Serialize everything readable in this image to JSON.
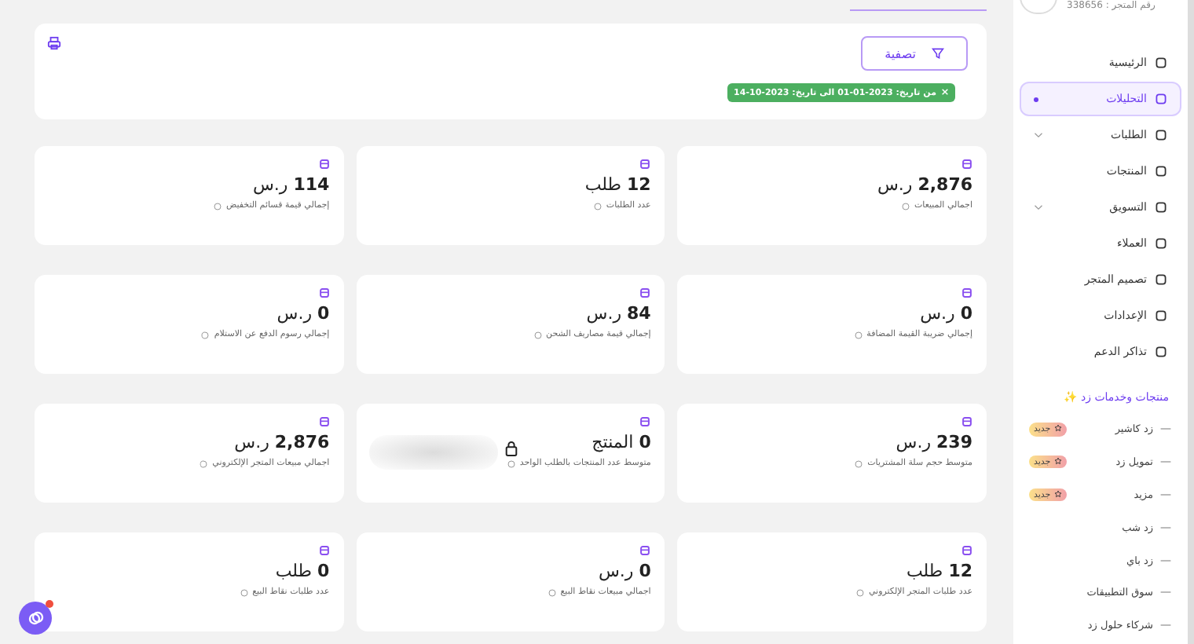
{
  "store": {
    "number_label": "رقم المتجر : 338656"
  },
  "nav": [
    {
      "label": "الرئيسية",
      "selected": false,
      "expandable": false
    },
    {
      "label": "التحليلات",
      "selected": true,
      "expandable": false
    },
    {
      "label": "الطلبات",
      "selected": false,
      "expandable": true
    },
    {
      "label": "المنتجات",
      "selected": false,
      "expandable": false
    },
    {
      "label": "التسويق",
      "selected": false,
      "expandable": true
    },
    {
      "label": "العملاء",
      "selected": false,
      "expandable": false
    },
    {
      "label": "تصميم المتجر",
      "selected": false,
      "expandable": false
    },
    {
      "label": "الإعدادات",
      "selected": false,
      "expandable": false
    },
    {
      "label": "تذاكر الدعم",
      "selected": false,
      "expandable": false
    }
  ],
  "services": {
    "title": "منتجات وخدمات زد ✨",
    "items": [
      {
        "label": "زد كاشير",
        "badge": "جديد"
      },
      {
        "label": "تمويل زد",
        "badge": "جديد"
      },
      {
        "label": "مزيد",
        "badge": "جديد"
      },
      {
        "label": "زد شب"
      },
      {
        "label": "زد باي"
      },
      {
        "label": "سوق التطبيقات"
      },
      {
        "label": "شركاء حلول زد"
      }
    ]
  },
  "filter": {
    "button": "تصفية",
    "chip": "من تاريخ: 2023-01-01 الى تاريخ: 2023-10-14"
  },
  "cards": [
    {
      "value": "2,876",
      "unit": "ر.س",
      "label": "اجمالي المبيعات",
      "locked": false
    },
    {
      "value": "12",
      "unit": "طلب",
      "label": "عدد الطلبات",
      "locked": false
    },
    {
      "value": "114",
      "unit": "ر.س",
      "label": "إجمالي قيمة قسائم التخفيض",
      "locked": false
    },
    {
      "value": "0",
      "unit": "ر.س",
      "label": "إجمالي ضريبة القيمة المضافة",
      "locked": false
    },
    {
      "value": "84",
      "unit": "ر.س",
      "label": "إجمالي قيمة مصاريف الشحن",
      "locked": false
    },
    {
      "value": "0",
      "unit": "ر.س",
      "label": "إجمالي رسوم الدفع عن الاستلام",
      "locked": false
    },
    {
      "value": "239",
      "unit": "ر.س",
      "label": "متوسط حجم سلة المشتريات",
      "locked": false
    },
    {
      "value": "0",
      "unit": "المنتج",
      "label": "متوسط عدد المنتجات بالطلب الواحد",
      "locked": true
    },
    {
      "value": "2,876",
      "unit": "ر.س",
      "label": "اجمالي مبيعات المتجر الإلكتروني",
      "locked": false
    },
    {
      "value": "12",
      "unit": "طلب",
      "label": "عدد طلبات المتجر الإلكتروني",
      "locked": false
    },
    {
      "value": "0",
      "unit": "ر.س",
      "label": "اجمالي مبيعات نقاط البيع",
      "locked": false
    },
    {
      "value": "0",
      "unit": "طلب",
      "label": "عدد طلبات نقاط البيع",
      "locked": false
    }
  ],
  "chat": {
    "unread": true
  }
}
